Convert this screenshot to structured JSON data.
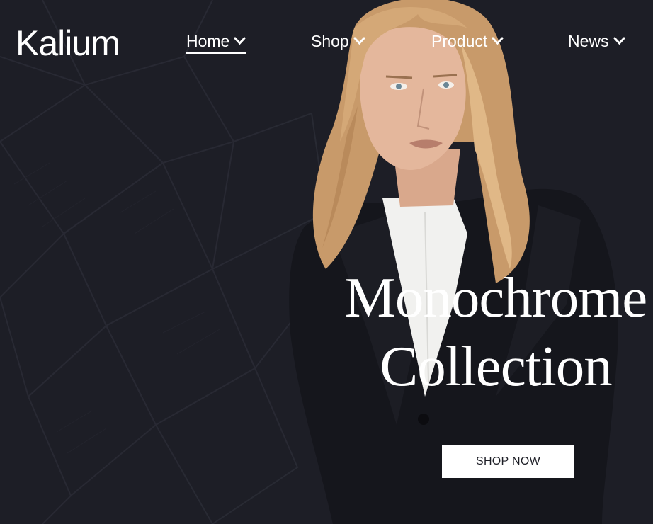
{
  "brand": {
    "logo_text": "Kalium"
  },
  "nav": {
    "items": [
      {
        "label": "Home",
        "active": true,
        "icon": "chevron-down-icon"
      },
      {
        "label": "Shop",
        "active": false,
        "icon": "chevron-down-icon"
      },
      {
        "label": "Product",
        "active": false,
        "icon": "chevron-down-icon"
      },
      {
        "label": "News",
        "active": false,
        "icon": "chevron-down-icon"
      }
    ]
  },
  "hero": {
    "title_line1": "Monochrome",
    "title_line2": "Collection",
    "cta_label": "SHOP NOW"
  },
  "colors": {
    "background": "#1d1e26",
    "text": "#ffffff",
    "button_bg": "#ffffff",
    "button_text": "#1d1e26"
  }
}
